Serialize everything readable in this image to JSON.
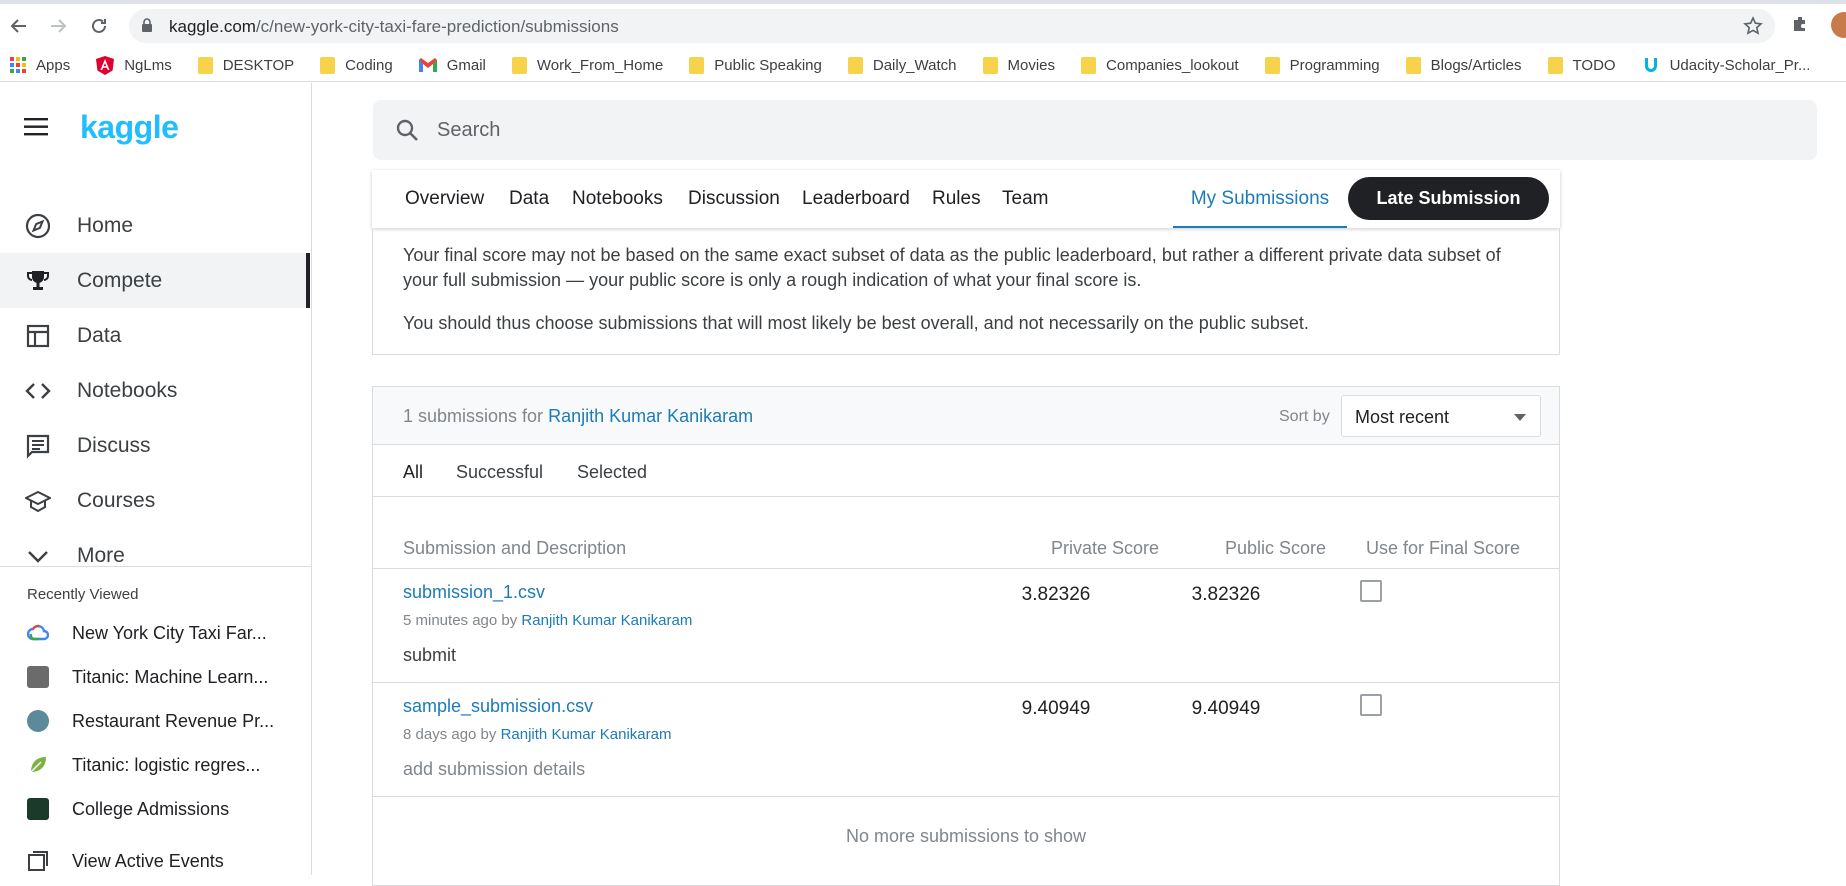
{
  "browser": {
    "url_host": "kaggle.com",
    "url_path": "/c/new-york-city-taxi-fare-prediction/submissions",
    "bookmarks": [
      "Apps",
      "NgLms",
      "DESKTOP",
      "Coding",
      "Gmail",
      "Work_From_Home",
      "Public Speaking",
      "Daily_Watch",
      "Movies",
      "Companies_lookout",
      "Programming",
      "Blogs/Articles",
      "TODO",
      "Udacity-Scholar_Pr..."
    ]
  },
  "sidebar": {
    "logo": "kaggle",
    "items": [
      {
        "label": "Home",
        "icon": "compass-icon"
      },
      {
        "label": "Compete",
        "icon": "trophy-icon"
      },
      {
        "label": "Data",
        "icon": "table-icon"
      },
      {
        "label": "Notebooks",
        "icon": "code-icon"
      },
      {
        "label": "Discuss",
        "icon": "comment-icon"
      },
      {
        "label": "Courses",
        "icon": "school-icon"
      },
      {
        "label": "More",
        "icon": "chevron-down-icon"
      }
    ],
    "recent_title": "Recently Viewed",
    "recent": [
      {
        "label": "New York City Taxi Far...",
        "color": "#4285f4"
      },
      {
        "label": "Titanic: Machine Learn...",
        "color": "#6b6b6b"
      },
      {
        "label": "Restaurant Revenue Pr...",
        "color": "#5b8a9a"
      },
      {
        "label": "Titanic: logistic regres...",
        "color": "#7cb342"
      },
      {
        "label": "College Admissions",
        "color": "#1b3a2a"
      }
    ],
    "view_events": "View Active Events"
  },
  "search": {
    "placeholder": "Search"
  },
  "tabs": {
    "items": [
      "Overview",
      "Data",
      "Notebooks",
      "Discussion",
      "Leaderboard",
      "Rules",
      "Team"
    ],
    "my_submissions": "My Submissions",
    "late_submission": "Late Submission"
  },
  "info": {
    "p1": "Your final score may not be based on the same exact subset of data as the public leaderboard, but rather a different private data subset of your full submission — your public score is only a rough indication of what your final score is.",
    "p2": "You should thus choose submissions that will most likely be best overall, and not necessarily on the public subset."
  },
  "submissions": {
    "count_text": "1 submissions for",
    "user": "Ranjith Kumar Kanikaram",
    "sort_label": "Sort by",
    "sort_value": "Most recent",
    "filters": [
      "All",
      "Successful",
      "Selected"
    ],
    "columns": {
      "name": "Submission and Description",
      "private": "Private Score",
      "public": "Public Score",
      "final": "Use for Final Score"
    },
    "rows": [
      {
        "file": "submission_1.csv",
        "when": "5 minutes ago by",
        "user": "Ranjith Kumar Kanikaram",
        "desc": "submit",
        "private": "3.82326",
        "public": "3.82326",
        "selected": false
      },
      {
        "file": "sample_submission.csv",
        "when": "8 days ago by",
        "user": "Ranjith Kumar Kanikaram",
        "desc": "add submission details",
        "private": "9.40949",
        "public": "9.40949",
        "selected": false
      }
    ],
    "no_more": "No more submissions to show"
  }
}
